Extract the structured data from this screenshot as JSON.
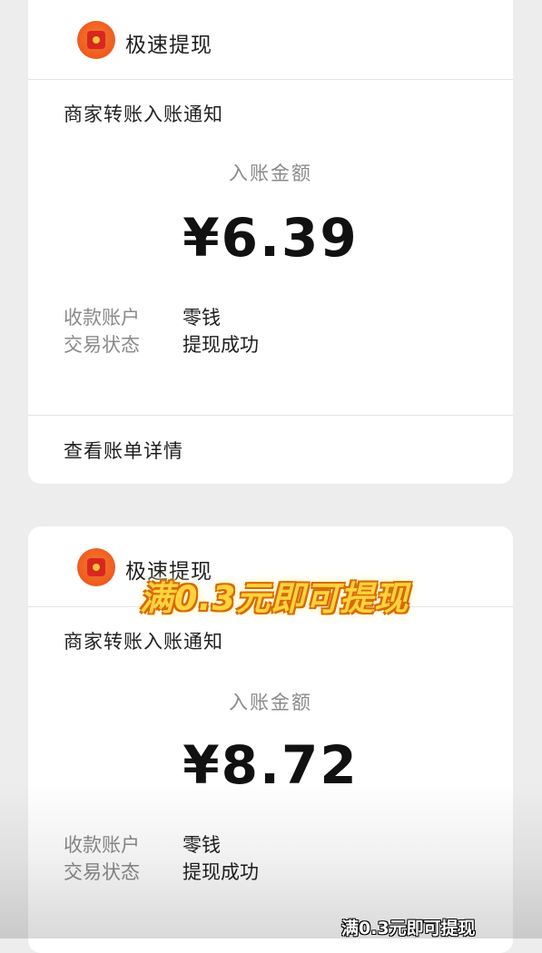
{
  "cards": [
    {
      "app_name": "极速提现",
      "notice_title": "商家转账入账通知",
      "amount_label": "入账金额",
      "amount": "¥6.39",
      "account_key": "收款账户",
      "account_value": "零钱",
      "status_key": "交易状态",
      "status_value": "提现成功",
      "details_link": "查看账单详情"
    },
    {
      "app_name": "极速提现",
      "notice_title": "商家转账入账通知",
      "amount_label": "入账金额",
      "amount": "¥8.72",
      "account_key": "收款账户",
      "account_value": "零钱",
      "status_key": "交易状态",
      "status_value": "提现成功"
    }
  ],
  "overlay": {
    "banner": "满0.3元即可提现",
    "caption": "满0.3元即可提现"
  },
  "icons": {
    "app_icon": "red-envelope-icon"
  },
  "colors": {
    "page_bg": "#ededed",
    "card_bg": "#ffffff",
    "icon_orange": "#ee5a1e",
    "banner_yellow": "#ffd23e"
  }
}
